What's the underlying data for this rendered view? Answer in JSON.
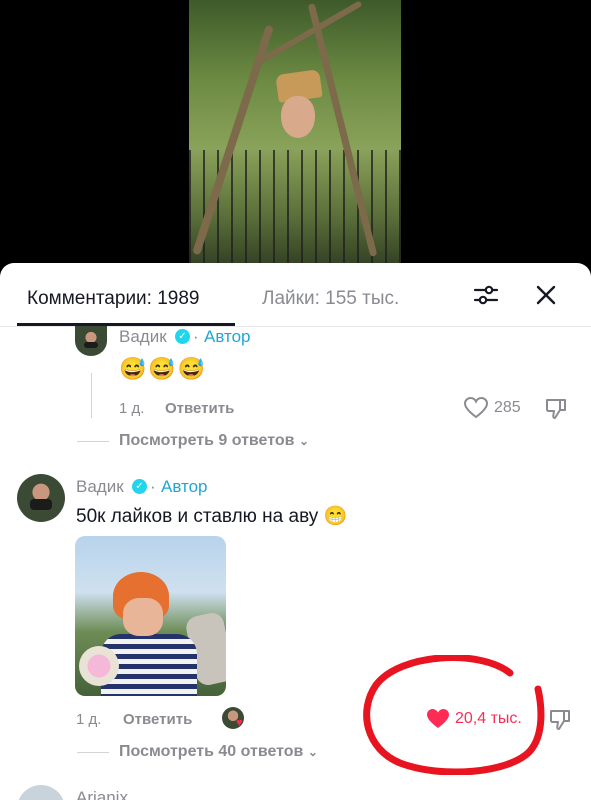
{
  "tabs": {
    "comments_label": "Комментарии: 1989",
    "likes_label": "Лайки: 155 тыс."
  },
  "icons": {
    "filter": "sliders-icon",
    "close": "close-icon",
    "verified": "verified-check-icon",
    "like": "heart-outline-icon",
    "liked": "heart-filled-icon",
    "dislike": "thumbs-down-icon",
    "chevron": "chevron-down-icon"
  },
  "colors": {
    "accent": "#fe2c55",
    "author_tag": "#20a6d6",
    "verified_badge": "#20d5ec",
    "muted_text": "#8a8b91",
    "annotation": "#e8141f"
  },
  "comments": [
    {
      "author": "Вадик",
      "separator": "·",
      "tag": "Автор",
      "text": "😅😅😅",
      "date": "1 д.",
      "reply_label": "Ответить",
      "likes": "285",
      "view_replies": "Посмотреть 9 ответов"
    },
    {
      "author": "Вадик",
      "separator": "·",
      "tag": "Автор",
      "text": "50к лайков и ставлю на аву 😁",
      "date": "1 д.",
      "reply_label": "Ответить",
      "likes": "20,4 тыс.",
      "view_replies": "Посмотреть 40 ответов"
    },
    {
      "author": "Arianix"
    }
  ]
}
